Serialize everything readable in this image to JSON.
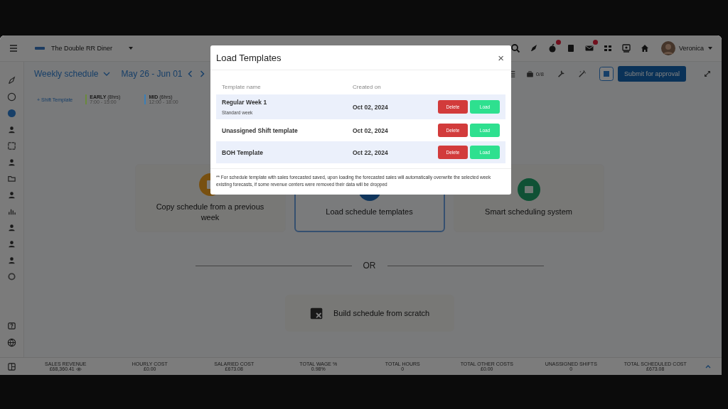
{
  "app_bar": {
    "store_name": "The Double RR Diner",
    "user_name": "Veronica"
  },
  "toolbar": {
    "view": "Weekly schedule",
    "date_range": "May 26 - Jun 01",
    "staff_count": "0/8",
    "submit_button": "Submit for approval"
  },
  "shift_templates": {
    "add_button": "+ Shift Template",
    "items": [
      {
        "name": "EARLY",
        "hours": "(8hrs)",
        "time": "7:00 - 15:00",
        "color": "#6a8a3c"
      },
      {
        "name": "MID",
        "hours": "(6hrs)",
        "time": "12:00 - 18:00",
        "color": "#3a7fb8"
      }
    ]
  },
  "options": [
    {
      "kind": "copy",
      "label": "Copy schedule from a previous week",
      "selected": false
    },
    {
      "kind": "templates",
      "label": "Load schedule templates",
      "selected": true
    },
    {
      "kind": "smart",
      "label": "Smart scheduling system",
      "selected": false
    }
  ],
  "divider_text": "OR",
  "build_option": {
    "label": "Build schedule from scratch"
  },
  "footer_stats": [
    {
      "label": "SALES REVENUE",
      "value": "£68,360.41",
      "has_eye": true
    },
    {
      "label": "HOURLY COST",
      "value": "£0.00",
      "has_eye": false
    },
    {
      "label": "SALARIED COST",
      "value": "£673.08",
      "has_eye": false
    },
    {
      "label": "TOTAL WAGE %",
      "value": "0.98%",
      "has_eye": false
    },
    {
      "label": "TOTAL HOURS",
      "value": "0",
      "has_eye": false
    },
    {
      "label": "TOTAL OTHER COSTS",
      "value": "£0.00",
      "has_eye": false
    },
    {
      "label": "UNASSIGNED SHIFTS",
      "value": "0",
      "has_eye": false
    },
    {
      "label": "TOTAL SCHEDULED COST",
      "value": "£673.08",
      "has_eye": false
    }
  ],
  "modal": {
    "title": "Load Templates",
    "close": "×",
    "columns": [
      "Template name",
      "Created on"
    ],
    "rows": [
      {
        "name": "Regular Week 1",
        "description": "Standard week",
        "created_on": "Oct 02, 2024",
        "delete_button": "Delete",
        "load_button": "Load"
      },
      {
        "name": "Unassigned Shift template",
        "created_on": "Oct 02, 2024",
        "delete_button": "Delete",
        "load_button": "Load"
      },
      {
        "name": "BOH Template",
        "created_on": "Oct 22, 2024",
        "delete_button": "Delete",
        "load_button": "Load"
      }
    ],
    "note": "** For schedule template with sales forecasted saved, upon loading the forecasted sales will automatically overwrite the selected week existing forecasts, if some revenue centers were removed their data will be dropped"
  }
}
